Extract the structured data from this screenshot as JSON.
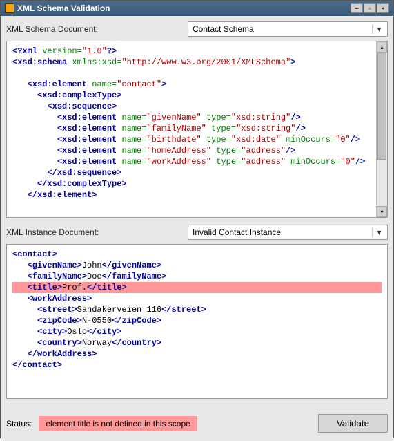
{
  "window": {
    "title": "XML Schema Validation"
  },
  "schema_section": {
    "label": "XML Schema Document:",
    "dropdown": "Contact Schema"
  },
  "instance_section": {
    "label": "XML Instance Document:",
    "dropdown": "Invalid Contact Instance"
  },
  "status": {
    "label": "Status:",
    "message": "element title is not defined in this scope",
    "button": "Validate"
  },
  "schema_code": {
    "pi_open": "<?xml ",
    "pi_version_attr": "version=",
    "pi_version_val": "\"1.0\"",
    "pi_close": "?>",
    "root_open": "<xsd:schema ",
    "xmlns_attr": "xmlns:xsd=",
    "xmlns_val": "\"http://www.w3.org/2001/XMLSchema\"",
    "gt": ">",
    "el_contact_open": "<xsd:element ",
    "name_attr": "name=",
    "contact_val": "\"contact\"",
    "ct_open": "<xsd:complexType>",
    "seq_open": "<xsd:sequence>",
    "given_val": "\"givenName\"",
    "type_attr": " type=",
    "string_val": "\"xsd:string\"",
    "slashgt": "/>",
    "family_val": "\"familyName\"",
    "birth_val": "\"birthdate\"",
    "date_val": "\"xsd:date\"",
    "min_attr": " minOccurs=",
    "zero_val": "\"0\"",
    "home_val": "\"homeAddress\"",
    "addr_val": "\"address\"",
    "work_val": "\"workAddress\"",
    "seq_close": "</xsd:sequence>",
    "ct_close": "</xsd:complexType>",
    "el_close": "</xsd:element>"
  },
  "inst_code": {
    "contact_open": "<contact>",
    "given_open": "<givenName>",
    "john": "John",
    "given_close": "</givenName>",
    "family_open": "<familyName>",
    "doe": "Doe",
    "family_close": "</familyName>",
    "title_open": "<title>",
    "prof": "Prof.",
    "title_close": "</title>",
    "work_open": "<workAddress>",
    "street_open": "<street>",
    "street_txt": "Sandakerveien 116",
    "street_close": "</street>",
    "zip_open": "<zipCode>",
    "zip_txt": "N-0550",
    "zip_close": "</zipCode>",
    "city_open": "<city>",
    "city_txt": "Oslo",
    "city_close": "</city>",
    "country_open": "<country>",
    "country_txt": "Norway",
    "country_close": "</country>",
    "work_close": "</workAddress>",
    "contact_close": "</contact>"
  }
}
